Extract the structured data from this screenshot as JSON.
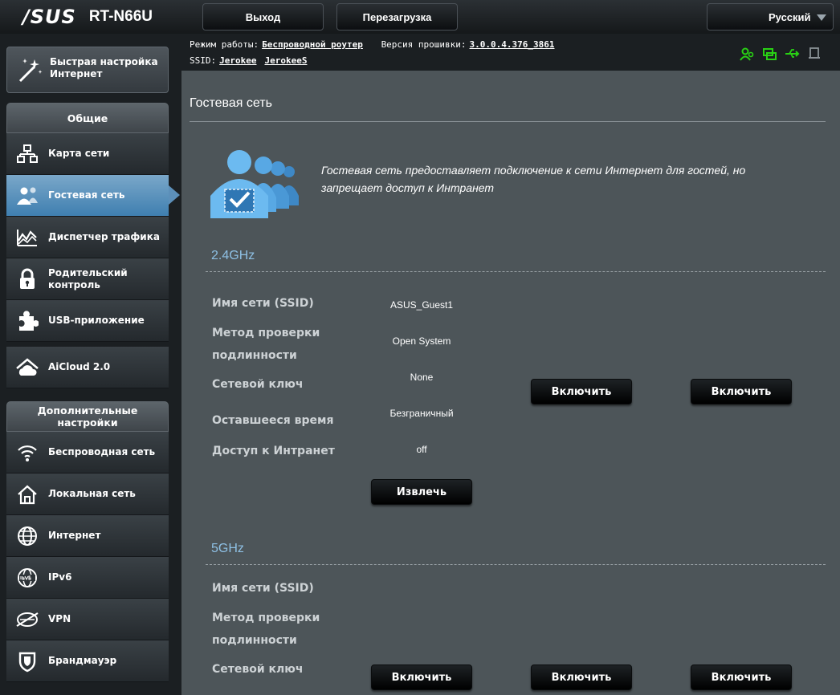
{
  "brand": {
    "logo": "/SUS",
    "model": "RT-N66U"
  },
  "topbar": {
    "logout": "Выход",
    "reboot": "Перезагрузка",
    "language": "Русский"
  },
  "info": {
    "mode_label": "Режим работы:",
    "mode_value": "Беспроводной роутер",
    "firmware_label": "Версия прошивки:",
    "firmware_value": "3.0.0.4.376_3861",
    "ssid_label": "SSID:",
    "ssid1": "Jerokee",
    "ssid2": "JerokeeS"
  },
  "sidebar": {
    "quick_setup": "Быстрая настройка Интернет",
    "general_header": "Общие",
    "general_items": [
      {
        "label": "Карта сети",
        "icon": "network-map-icon"
      },
      {
        "label": "Гостевая сеть",
        "icon": "guest-network-icon",
        "active": true
      },
      {
        "label": "Диспетчер трафика",
        "icon": "traffic-manager-icon"
      },
      {
        "label": "Родительский контроль",
        "icon": "parental-lock-icon"
      },
      {
        "label": "USB-приложение",
        "icon": "usb-puzzle-icon"
      },
      {
        "label": "AiCloud 2.0",
        "icon": "aicloud-icon"
      }
    ],
    "advanced_header": "Дополнительные настройки",
    "advanced_items": [
      {
        "label": "Беспроводная сеть",
        "icon": "wireless-icon"
      },
      {
        "label": "Локальная сеть",
        "icon": "home-lan-icon"
      },
      {
        "label": "Интернет",
        "icon": "globe-icon"
      },
      {
        "label": "IPv6",
        "icon": "ipv6-icon"
      },
      {
        "label": "VPN",
        "icon": "vpn-icon"
      },
      {
        "label": "Брандмауэр",
        "icon": "firewall-shield-icon"
      }
    ]
  },
  "main": {
    "title": "Гостевая сеть",
    "description": "Гостевая сеть предоставляет подключение к сети Интернет для гостей, но запрещает доступ к Интранет",
    "band24": {
      "title": "2.4GHz",
      "labels": [
        "Имя сети (SSID)",
        "Метод проверки подлинности",
        "Сетевой ключ",
        "Оставшееся время",
        "Доступ к Интранет"
      ],
      "values": {
        "ssid": "ASUS_Guest1",
        "auth": "Open System",
        "key": "None",
        "time": "Безграничный",
        "intranet": "off"
      },
      "enable_btn": "Включить",
      "remove_btn": "Извлечь"
    },
    "band5": {
      "title": "5GHz",
      "labels": [
        "Имя сети (SSID)",
        "Метод проверки подлинности",
        "Сетевой ключ"
      ],
      "enable_btn": "Включить"
    }
  },
  "colors": {
    "accent_blue": "#8ec0e4",
    "active_item": "#4f8dbd",
    "status_green": "#29d014"
  }
}
